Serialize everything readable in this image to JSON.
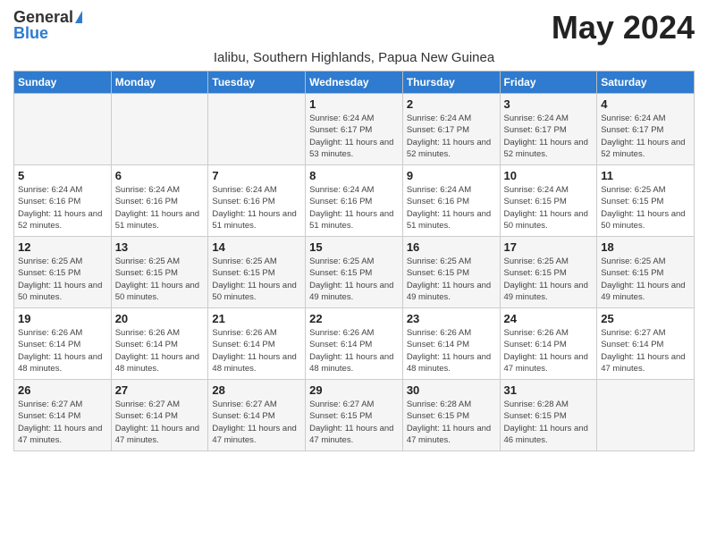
{
  "header": {
    "logo_general": "General",
    "logo_blue": "Blue",
    "month_title": "May 2024",
    "subtitle": "Ialibu, Southern Highlands, Papua New Guinea"
  },
  "days_of_week": [
    "Sunday",
    "Monday",
    "Tuesday",
    "Wednesday",
    "Thursday",
    "Friday",
    "Saturday"
  ],
  "weeks": [
    [
      {
        "day": "",
        "info": ""
      },
      {
        "day": "",
        "info": ""
      },
      {
        "day": "",
        "info": ""
      },
      {
        "day": "1",
        "info": "Sunrise: 6:24 AM\nSunset: 6:17 PM\nDaylight: 11 hours and 53 minutes."
      },
      {
        "day": "2",
        "info": "Sunrise: 6:24 AM\nSunset: 6:17 PM\nDaylight: 11 hours and 52 minutes."
      },
      {
        "day": "3",
        "info": "Sunrise: 6:24 AM\nSunset: 6:17 PM\nDaylight: 11 hours and 52 minutes."
      },
      {
        "day": "4",
        "info": "Sunrise: 6:24 AM\nSunset: 6:17 PM\nDaylight: 11 hours and 52 minutes."
      }
    ],
    [
      {
        "day": "5",
        "info": "Sunrise: 6:24 AM\nSunset: 6:16 PM\nDaylight: 11 hours and 52 minutes."
      },
      {
        "day": "6",
        "info": "Sunrise: 6:24 AM\nSunset: 6:16 PM\nDaylight: 11 hours and 51 minutes."
      },
      {
        "day": "7",
        "info": "Sunrise: 6:24 AM\nSunset: 6:16 PM\nDaylight: 11 hours and 51 minutes."
      },
      {
        "day": "8",
        "info": "Sunrise: 6:24 AM\nSunset: 6:16 PM\nDaylight: 11 hours and 51 minutes."
      },
      {
        "day": "9",
        "info": "Sunrise: 6:24 AM\nSunset: 6:16 PM\nDaylight: 11 hours and 51 minutes."
      },
      {
        "day": "10",
        "info": "Sunrise: 6:24 AM\nSunset: 6:15 PM\nDaylight: 11 hours and 50 minutes."
      },
      {
        "day": "11",
        "info": "Sunrise: 6:25 AM\nSunset: 6:15 PM\nDaylight: 11 hours and 50 minutes."
      }
    ],
    [
      {
        "day": "12",
        "info": "Sunrise: 6:25 AM\nSunset: 6:15 PM\nDaylight: 11 hours and 50 minutes."
      },
      {
        "day": "13",
        "info": "Sunrise: 6:25 AM\nSunset: 6:15 PM\nDaylight: 11 hours and 50 minutes."
      },
      {
        "day": "14",
        "info": "Sunrise: 6:25 AM\nSunset: 6:15 PM\nDaylight: 11 hours and 50 minutes."
      },
      {
        "day": "15",
        "info": "Sunrise: 6:25 AM\nSunset: 6:15 PM\nDaylight: 11 hours and 49 minutes."
      },
      {
        "day": "16",
        "info": "Sunrise: 6:25 AM\nSunset: 6:15 PM\nDaylight: 11 hours and 49 minutes."
      },
      {
        "day": "17",
        "info": "Sunrise: 6:25 AM\nSunset: 6:15 PM\nDaylight: 11 hours and 49 minutes."
      },
      {
        "day": "18",
        "info": "Sunrise: 6:25 AM\nSunset: 6:15 PM\nDaylight: 11 hours and 49 minutes."
      }
    ],
    [
      {
        "day": "19",
        "info": "Sunrise: 6:26 AM\nSunset: 6:14 PM\nDaylight: 11 hours and 48 minutes."
      },
      {
        "day": "20",
        "info": "Sunrise: 6:26 AM\nSunset: 6:14 PM\nDaylight: 11 hours and 48 minutes."
      },
      {
        "day": "21",
        "info": "Sunrise: 6:26 AM\nSunset: 6:14 PM\nDaylight: 11 hours and 48 minutes."
      },
      {
        "day": "22",
        "info": "Sunrise: 6:26 AM\nSunset: 6:14 PM\nDaylight: 11 hours and 48 minutes."
      },
      {
        "day": "23",
        "info": "Sunrise: 6:26 AM\nSunset: 6:14 PM\nDaylight: 11 hours and 48 minutes."
      },
      {
        "day": "24",
        "info": "Sunrise: 6:26 AM\nSunset: 6:14 PM\nDaylight: 11 hours and 47 minutes."
      },
      {
        "day": "25",
        "info": "Sunrise: 6:27 AM\nSunset: 6:14 PM\nDaylight: 11 hours and 47 minutes."
      }
    ],
    [
      {
        "day": "26",
        "info": "Sunrise: 6:27 AM\nSunset: 6:14 PM\nDaylight: 11 hours and 47 minutes."
      },
      {
        "day": "27",
        "info": "Sunrise: 6:27 AM\nSunset: 6:14 PM\nDaylight: 11 hours and 47 minutes."
      },
      {
        "day": "28",
        "info": "Sunrise: 6:27 AM\nSunset: 6:14 PM\nDaylight: 11 hours and 47 minutes."
      },
      {
        "day": "29",
        "info": "Sunrise: 6:27 AM\nSunset: 6:15 PM\nDaylight: 11 hours and 47 minutes."
      },
      {
        "day": "30",
        "info": "Sunrise: 6:28 AM\nSunset: 6:15 PM\nDaylight: 11 hours and 47 minutes."
      },
      {
        "day": "31",
        "info": "Sunrise: 6:28 AM\nSunset: 6:15 PM\nDaylight: 11 hours and 46 minutes."
      },
      {
        "day": "",
        "info": ""
      }
    ]
  ]
}
